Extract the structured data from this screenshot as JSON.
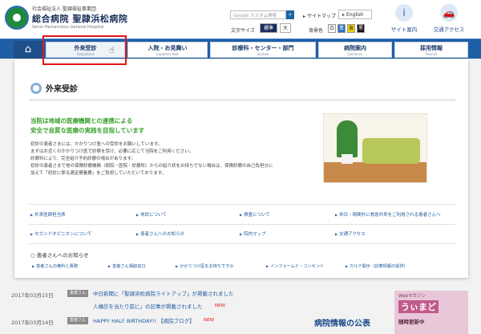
{
  "header": {
    "org_line": "社会福祉法人 聖隷福祉事業団",
    "hospital_name": "総合病院 聖隷浜松病院",
    "hospital_name_en": "Seirei Hamamatsu General Hospital",
    "search_placeholder": "Google カスタム検索",
    "sitemap": "サイトマップ",
    "english": "English",
    "font_size_label": "文字サイズ",
    "font_standard": "標準",
    "font_large": "大",
    "bg_color_label": "背景色",
    "bg_white": "白",
    "bg_blue": "青",
    "bg_yellow": "黄",
    "bg_black": "黒",
    "site_guide": "サイト案内",
    "access": "交通アクセス"
  },
  "nav": {
    "items": [
      {
        "label": "外来受診",
        "sub": "Outpatient"
      },
      {
        "label": "入院・お見舞い",
        "sub": "Inpatient Visit"
      },
      {
        "label": "診療科・センター・部門",
        "sub": "Section"
      },
      {
        "label": "病院案内",
        "sub": "Guidance"
      },
      {
        "label": "採用情報",
        "sub": "Recruit"
      }
    ]
  },
  "panel": {
    "title": "外来受診",
    "lead1": "当院は地域の医療機関との連携による",
    "lead2": "安全で良質な医療の実践を目指しています",
    "body": [
      "初診の患者さまには、かかりつけ医への受診をお願いしています。",
      "まずはお近くのかかりつけ医で診察を受け、必要に応じて当院をご利用ください。",
      "診療科により、完全紹介予約診療の場合があります。",
      "初診の患者さまで他の保険診療機関（病院・医院・診療所）からの紹介状をお持ちでない場合は、保険診療の自己負担分に",
      "加えて「初診に係る選定療養費」をご負担していただいております。"
    ],
    "links_row1": [
      "外来医師担当表",
      "休診について",
      "検査について",
      "休日・時間外に救急外来をご利用される患者さんへ"
    ],
    "links_row2": [
      "セカンドオピニオンについて",
      "患者さんへのお知らせ",
      "院内マップ",
      "交通アクセス"
    ],
    "notice_heading": "患者さんへのお知らせ",
    "notices": [
      "患者さんの権利と責務",
      "患者さん相談窓口",
      "かかりつけ医をお持ちですか",
      "インフォームド・コンセント",
      "カルテ開示（診療情報の提供）"
    ]
  },
  "news": {
    "rows": [
      {
        "date": "2017年03月15日",
        "tag": "患者さん",
        "text": "中日新聞に「聖隷浜松病院ライトアップ」が掲載されました",
        "new": "NEW"
      },
      {
        "date": "",
        "tag": "",
        "text": "人棟診を当たり前に」の記事が掲載されました",
        "new": "NEW"
      },
      {
        "date": "2017年03月14日",
        "tag": "患者さん",
        "text": "HAPPY HALF BIRTHDAY!! 【病院ブログ】",
        "new": "NEW"
      }
    ],
    "banner": "病院情報の公表",
    "webmag_label": "Webマガジン",
    "webmag_title": "うぃまど",
    "webmag_sub": "随時更新中"
  }
}
